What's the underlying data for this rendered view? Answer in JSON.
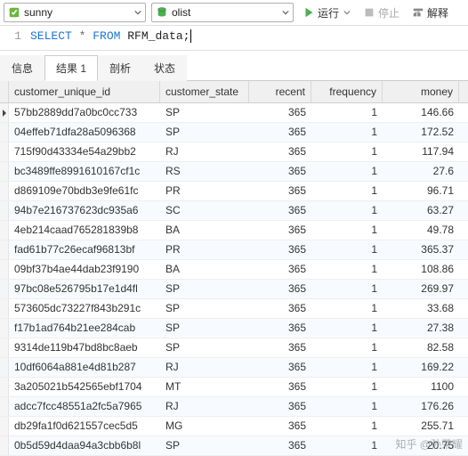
{
  "toolbar": {
    "conn_dropdown": "sunny",
    "db_dropdown": "olist",
    "run_label": "运行",
    "stop_label": "停止",
    "explain_label": "解释"
  },
  "editor": {
    "line_no": "1",
    "kw_select": "SELECT",
    "sym_star": " * ",
    "kw_from": "FROM",
    "table": " RFM_data",
    "semicolon": ";"
  },
  "tabs": {
    "info": "信息",
    "result": "结果 1",
    "profile": "剖析",
    "status": "状态"
  },
  "columns": {
    "c0": "customer_unique_id",
    "c1": "customer_state",
    "c2": "recent",
    "c3": "frequency",
    "c4": "money"
  },
  "rows": [
    {
      "id": "57bb2889dd7a0bc0cc733",
      "state": "SP",
      "recent": "365",
      "freq": "1",
      "money": "146.66"
    },
    {
      "id": "04effeb71dfa28a5096368",
      "state": "SP",
      "recent": "365",
      "freq": "1",
      "money": "172.52"
    },
    {
      "id": "715f90d43334e54a29bb2",
      "state": "RJ",
      "recent": "365",
      "freq": "1",
      "money": "117.94"
    },
    {
      "id": "bc3489ffe8991610167cf1c",
      "state": "RS",
      "recent": "365",
      "freq": "1",
      "money": "27.6"
    },
    {
      "id": "d869109e70bdb3e9fe61fc",
      "state": "PR",
      "recent": "365",
      "freq": "1",
      "money": "96.71"
    },
    {
      "id": "94b7e216737623dc935a6",
      "state": "SC",
      "recent": "365",
      "freq": "1",
      "money": "63.27"
    },
    {
      "id": "4eb214caad765281839b8",
      "state": "BA",
      "recent": "365",
      "freq": "1",
      "money": "49.78"
    },
    {
      "id": "fad61b77c26ecaf96813bf",
      "state": "PR",
      "recent": "365",
      "freq": "1",
      "money": "365.37"
    },
    {
      "id": "09bf37b4ae44dab23f9190",
      "state": "BA",
      "recent": "365",
      "freq": "1",
      "money": "108.86"
    },
    {
      "id": "97bc08e526795b17e1d4fl",
      "state": "SP",
      "recent": "365",
      "freq": "1",
      "money": "269.97"
    },
    {
      "id": "573605dc73227f843b291c",
      "state": "SP",
      "recent": "365",
      "freq": "1",
      "money": "33.68"
    },
    {
      "id": "f17b1ad764b21ee284cab",
      "state": "SP",
      "recent": "365",
      "freq": "1",
      "money": "27.38"
    },
    {
      "id": "9314de119b47bd8bc8aeb",
      "state": "SP",
      "recent": "365",
      "freq": "1",
      "money": "82.58"
    },
    {
      "id": "10df6064a881e4d81b287",
      "state": "RJ",
      "recent": "365",
      "freq": "1",
      "money": "169.22"
    },
    {
      "id": "3a205021b542565ebf1704",
      "state": "MT",
      "recent": "365",
      "freq": "1",
      "money": "1100"
    },
    {
      "id": "adcc7fcc48551a2fc5a7965",
      "state": "RJ",
      "recent": "365",
      "freq": "1",
      "money": "176.26"
    },
    {
      "id": "db29fa1f0d621557cec5d5",
      "state": "MG",
      "recent": "365",
      "freq": "1",
      "money": "255.71"
    },
    {
      "id": "0b5d59d4daa94a3cbb6b8l",
      "state": "SP",
      "recent": "365",
      "freq": "1",
      "money": "20.75"
    }
  ],
  "watermark": "知乎 @孙荣耀"
}
